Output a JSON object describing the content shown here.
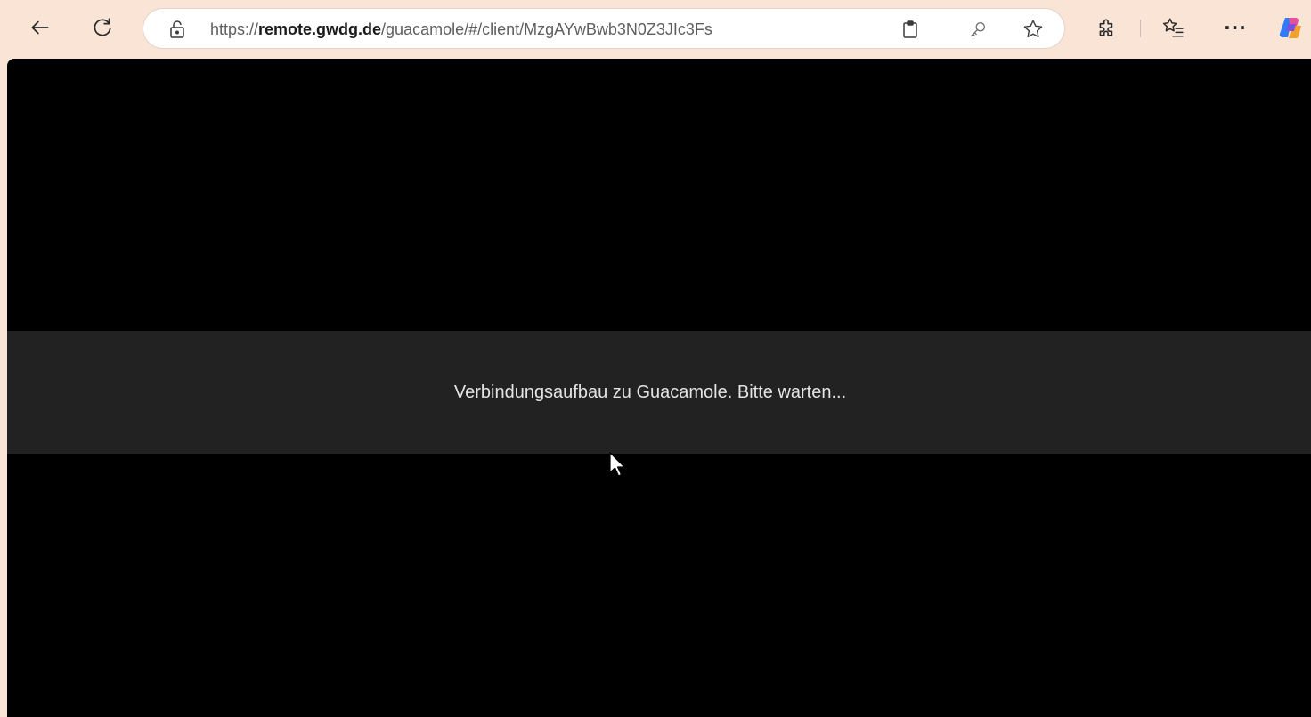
{
  "browser": {
    "url": {
      "scheme": "https://",
      "host": "remote.gwdg.de",
      "path": "/guacamole/#/client/MzgAYwBwb3N0Z3JIc3Fs"
    },
    "icons": {
      "back": "arrow-left-icon",
      "refresh": "refresh-icon",
      "lock": "lock-icon",
      "clipboard": "clipboard-icon",
      "key": "key-icon",
      "favorite": "star-icon",
      "extensions": "puzzle-icon",
      "favorites": "favorites-list-icon",
      "more": "ellipsis-icon",
      "copilot": "copilot-icon"
    },
    "more_label": "···"
  },
  "page": {
    "status_message": "Verbindungsaufbau zu Guacamole. Bitte warten..."
  },
  "colors": {
    "frame": "#f9e4d6",
    "content_bg": "#000000",
    "banner_bg": "#222222",
    "banner_text": "#e4e4e4"
  }
}
